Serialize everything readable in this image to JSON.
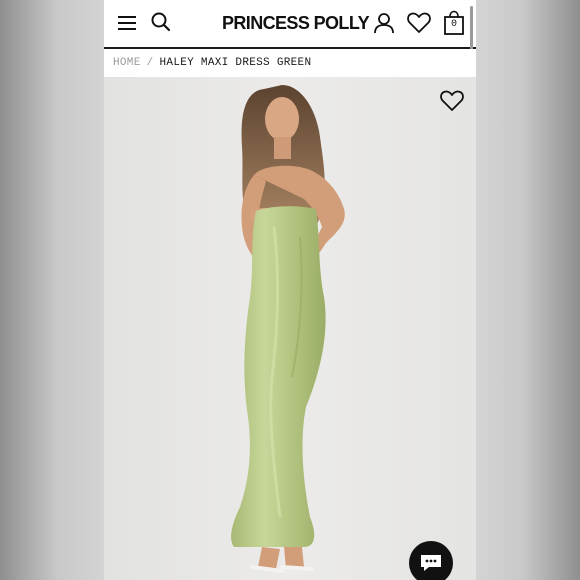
{
  "header": {
    "logo": "PRINCESS POLLY",
    "bag_count": "0"
  },
  "breadcrumb": {
    "home": "HOME",
    "separator": "/",
    "current": "HALEY MAXI DRESS GREEN"
  },
  "icons": {
    "menu": "hamburger-menu-icon",
    "search": "search-icon",
    "account": "user-icon",
    "wishlist": "heart-icon",
    "bag": "shopping-bag-icon",
    "favorite": "heart-outline-icon",
    "chat": "chat-bubble-icon"
  },
  "colors": {
    "dress": "#b9c98a",
    "background": "#e6e6e4",
    "text": "#1a1a1a"
  }
}
